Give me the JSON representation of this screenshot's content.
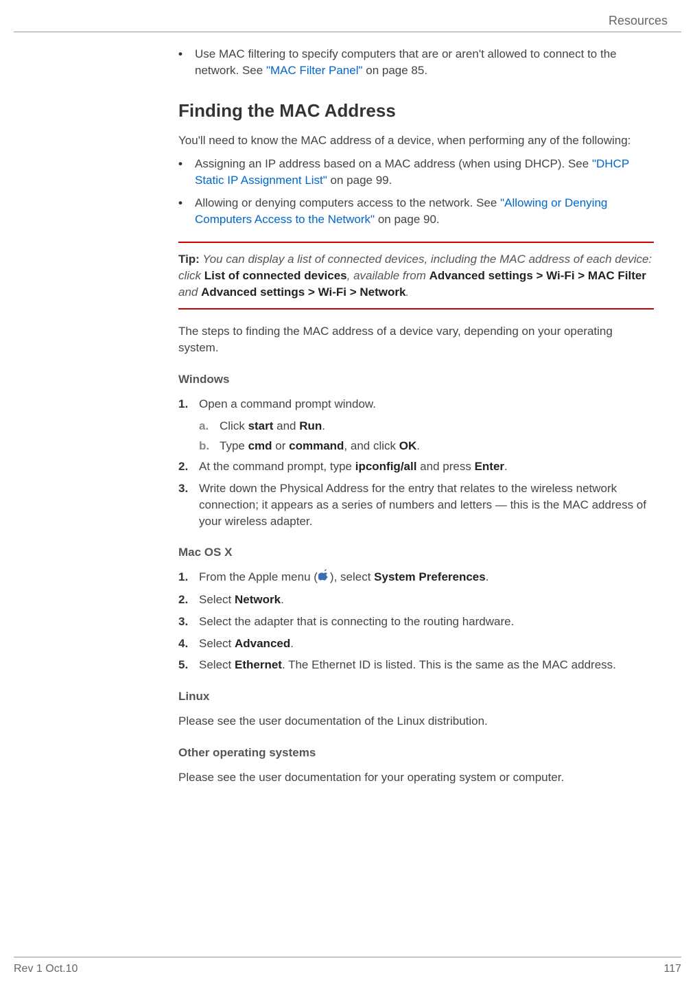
{
  "header": {
    "section": "Resources"
  },
  "intro_bullet": {
    "text1": "Use MAC filtering to specify computers that are or aren't allowed to connect to the network. See ",
    "link": "\"MAC Filter Panel\"",
    "text2": " on page 85."
  },
  "heading": "Finding the MAC Address",
  "intro_para": "You'll need to know the MAC address of a device, when performing any of the following:",
  "bullets": [
    {
      "text1": "Assigning an IP address based on a MAC address (when using DHCP). See ",
      "link": "\"DHCP Static IP Assignment List\"",
      "text2": " on page 99."
    },
    {
      "text1": "Allowing or denying computers access to the network. See ",
      "link": "\"Allowing or Denying Computers Access to the Network\"",
      "text2": " on page 90."
    }
  ],
  "tip": {
    "label": "Tip:",
    "t1": " You can display a list of connected devices, including the MAC address of each device: click ",
    "b1": "List of connected devices",
    "t2": ", available from ",
    "b2": "Advanced settings",
    "t3": " > ",
    "b3": "Wi-Fi",
    "t4": " > ",
    "b4": "MAC Filter",
    "t5": " and ",
    "b5": "Advanced settings",
    "t6": " > ",
    "b6": "Wi-Fi",
    "t7": " > ",
    "b7": "Network",
    "t8": "."
  },
  "para_after_tip": "The steps to finding the MAC address of a device vary, depending on your operating system.",
  "windows": {
    "heading": "Windows",
    "s1": {
      "num": "1.",
      "text": "Open a command prompt window."
    },
    "s1a": {
      "num": "a.",
      "t1": "Click ",
      "b1": "start",
      "t2": " and ",
      "b2": "Run",
      "t3": "."
    },
    "s1b": {
      "num": "b.",
      "t1": "Type ",
      "b1": "cmd",
      "t2": " or ",
      "b2": "command",
      "t3": ", and click ",
      "b3": "OK",
      "t4": "."
    },
    "s2": {
      "num": "2.",
      "t1": "At the command prompt, type ",
      "b1": "ipconfig/all",
      "t2": " and press ",
      "b2": "Enter",
      "t3": "."
    },
    "s3": {
      "num": "3.",
      "text": "Write down the Physical Address for the entry that relates to the wireless network connection; it appears as a series of numbers and letters — this is the MAC address of your wireless adapter."
    }
  },
  "macosx": {
    "heading": "Mac OS X",
    "s1": {
      "num": "1.",
      "t1": "From the Apple menu (",
      "t2": "), select ",
      "b1": "System Preferences",
      "t3": "."
    },
    "s2": {
      "num": "2.",
      "t1": "Select ",
      "b1": "Network",
      "t2": "."
    },
    "s3": {
      "num": "3.",
      "text": "Select the adapter that is connecting to the routing hardware."
    },
    "s4": {
      "num": "4.",
      "t1": "Select ",
      "b1": "Advanced",
      "t2": "."
    },
    "s5": {
      "num": "5.",
      "t1": "Select ",
      "b1": "Ethernet",
      "t2": ". The Ethernet ID is listed. This is the same as the MAC address."
    }
  },
  "linux": {
    "heading": "Linux",
    "text": "Please see the user documentation of the Linux distribution."
  },
  "other": {
    "heading": "Other operating systems",
    "text": "Please see the user documentation for your operating system or computer."
  },
  "footer": {
    "left": "Rev 1  Oct.10",
    "right": "117"
  }
}
